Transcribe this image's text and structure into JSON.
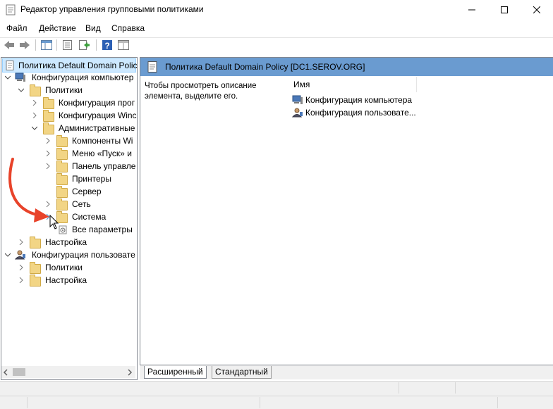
{
  "window": {
    "title": "Редактор управления групповыми политиками",
    "controls": {
      "minimize": "minimize",
      "maximize": "maximize",
      "close": "close"
    }
  },
  "menu": [
    "Файл",
    "Действие",
    "Вид",
    "Справка"
  ],
  "toolbar": {
    "icons": [
      "back-arrow-icon",
      "forward-arrow-icon",
      "show-tree-icon",
      "properties-icon",
      "export-list-icon",
      "help-icon",
      "console-view-icon"
    ]
  },
  "tree": {
    "root": "Политика Default Domain Polic",
    "computer_config": "Конфигурация компьютер",
    "policies": "Политики",
    "software_config": "Конфигурация прог",
    "windows_config": "Конфигурация Winc",
    "admin_templates": "Административные",
    "windows_components": "Компоненты Wi",
    "start_menu": "Меню «Пуск» и",
    "control_panel": "Панель управле",
    "printers": "Принтеры",
    "server": "Сервер",
    "network": "Сеть",
    "system": "Система",
    "all_settings": "Все параметры",
    "preferences": "Настройка",
    "user_config": "Конфигурация пользовате",
    "user_policies": "Политики",
    "user_preferences": "Настройка"
  },
  "right": {
    "header": "Политика Default Domain Policy [DC1.SEROV.ORG]",
    "description": "Чтобы просмотреть описание элемента, выделите его.",
    "column_name": "Имя",
    "items": [
      "Конфигурация компьютера",
      "Конфигурация пользовате..."
    ]
  },
  "tabs": {
    "extended": "Расширенный",
    "standard": "Стандартный"
  },
  "colors": {
    "header_blue": "#6a9bd0",
    "selection": "#cce8ff",
    "arrow_red": "#e8432a",
    "folder": "#f2d585"
  }
}
